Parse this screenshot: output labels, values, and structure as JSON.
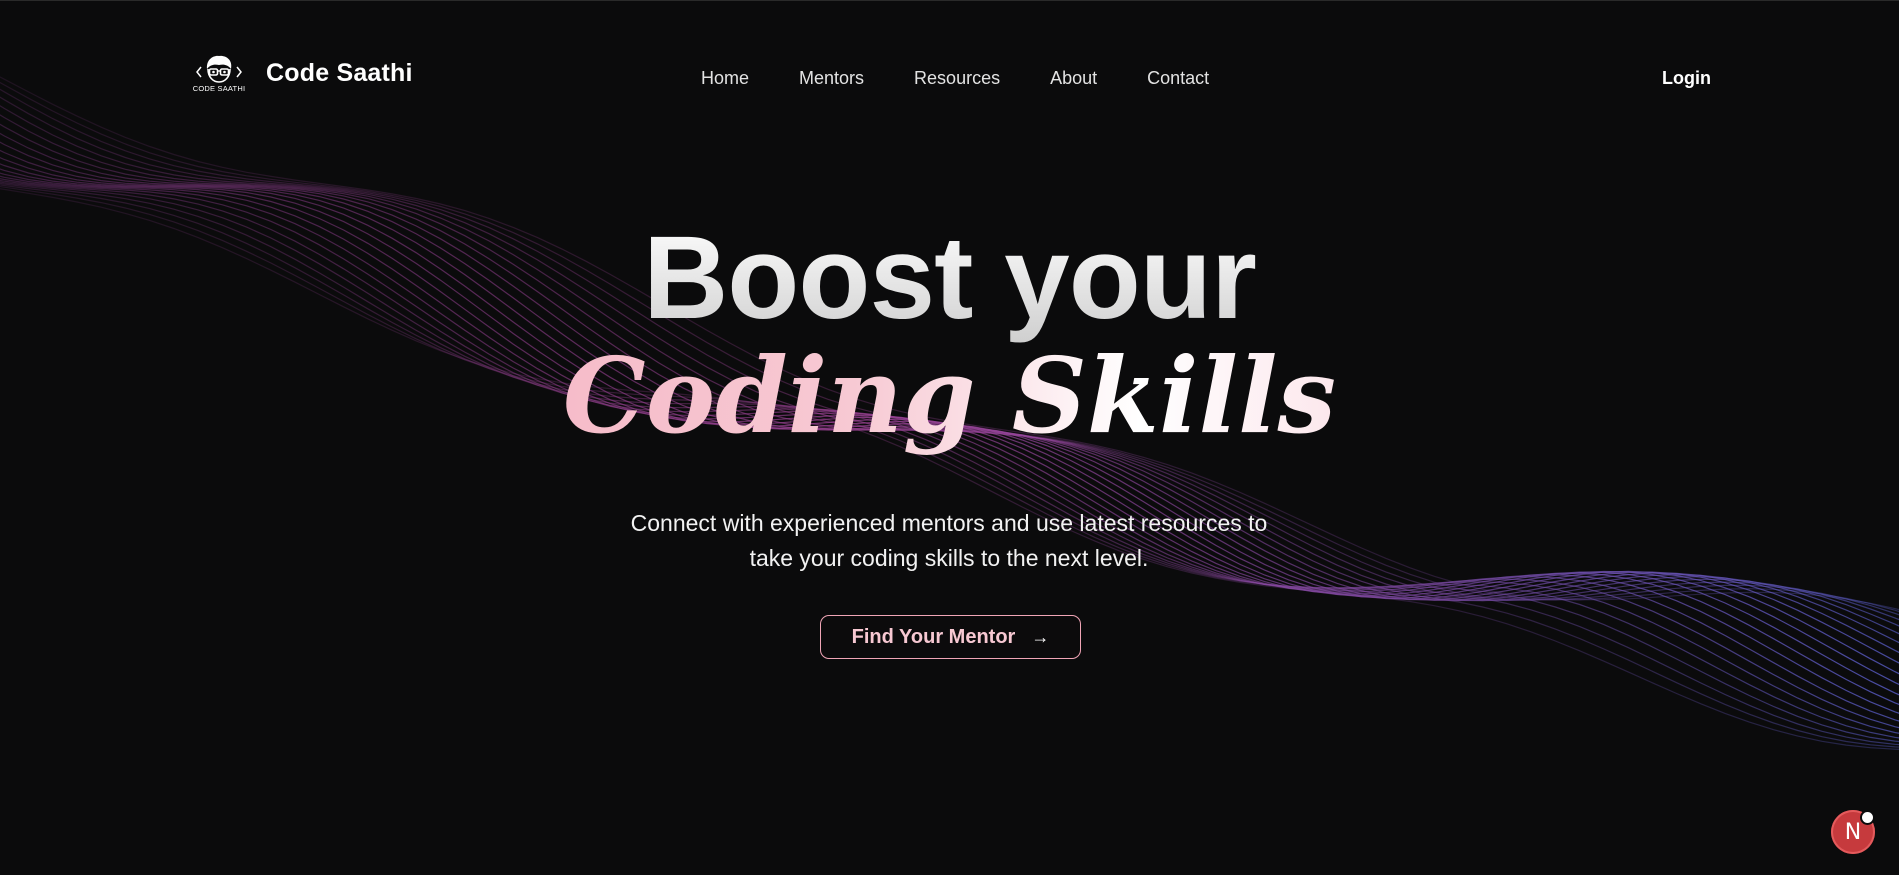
{
  "brand": {
    "logo_caption": "CODE SAATHI",
    "name": "Code Saathi",
    "icon": "coder-with-glasses-logo"
  },
  "nav": {
    "items": [
      {
        "label": "Home"
      },
      {
        "label": "Mentors"
      },
      {
        "label": "Resources"
      },
      {
        "label": "About"
      },
      {
        "label": "Contact"
      }
    ],
    "login_label": "Login"
  },
  "hero": {
    "title_line1": "Boost your",
    "title_line2": "Coding Skills",
    "subtitle_line1": "Connect with experienced mentors and use latest resources to",
    "subtitle_line2": "take your coding skills to the next level.",
    "cta_label": "Find Your Mentor",
    "cta_icon": "arrow-right-icon"
  },
  "floating_badge": {
    "letter": "N",
    "icon": "next-dev-indicator-icon"
  },
  "colors": {
    "background": "#0b0b0c",
    "accent_pink": "#f4a3b7",
    "wave_purple": "#8a3e8e",
    "wave_blue": "#5a5fd0",
    "badge_red": "#c63a3d"
  }
}
